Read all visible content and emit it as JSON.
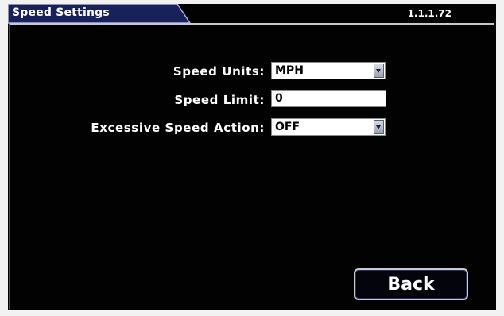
{
  "header": {
    "title": "Speed Settings",
    "version": "1.1.1.72"
  },
  "form": {
    "speed_units": {
      "label": "Speed Units:",
      "value": "MPH",
      "arrow_icon": "dropdown-arrow-icon"
    },
    "speed_limit": {
      "label": "Speed Limit:",
      "value": "0"
    },
    "excessive_speed_action": {
      "label": "Excessive Speed Action:",
      "value": "OFF",
      "arrow_icon": "dropdown-arrow-icon"
    }
  },
  "footer": {
    "back_label": "Back"
  },
  "colors": {
    "tab_fill": "#18215a",
    "screen_background": "#020202",
    "border": "#c8c8c8"
  }
}
